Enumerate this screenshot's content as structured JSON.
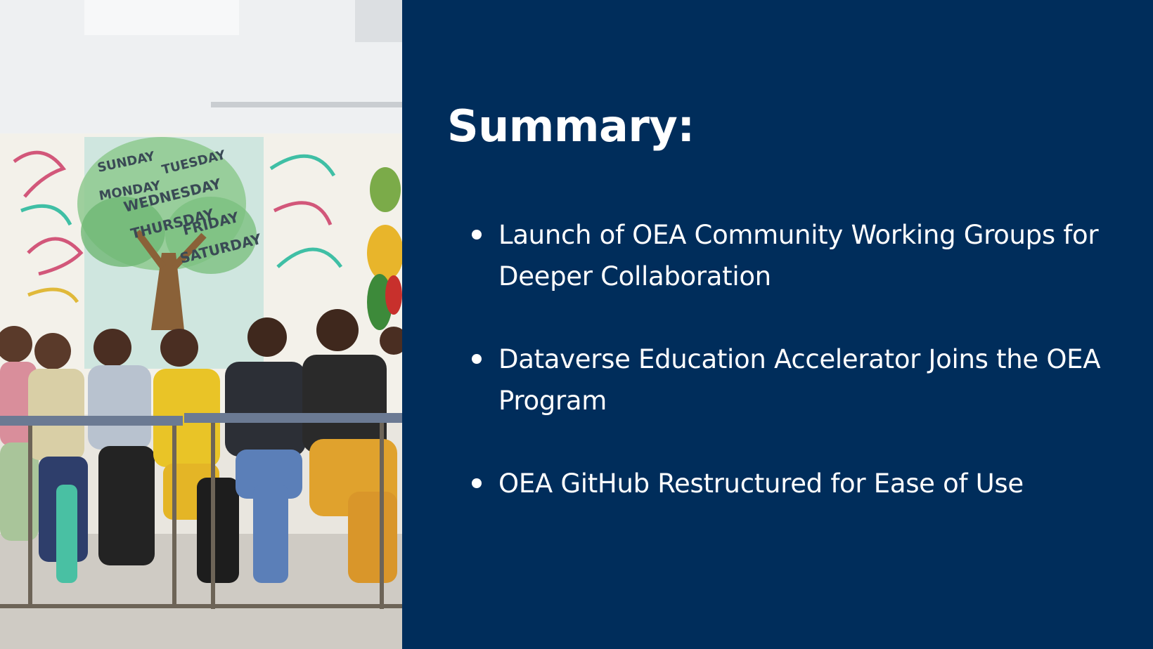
{
  "colors": {
    "background": "#002d5b",
    "text": "#ffffff"
  },
  "photo": {
    "icon": "classroom-photo",
    "wall_days": [
      "SUNDAY",
      "MONDAY",
      "TUESDAY",
      "WEDNESDAY",
      "THURSDAY",
      "FRIDAY",
      "SATURDAY"
    ]
  },
  "slide": {
    "title": "Summary:",
    "bullets": [
      {
        "text": "Launch of OEA Community Working Groups for Deeper Collaboration"
      },
      {
        "text": "Dataverse Education Accelerator Joins the OEA Program"
      },
      {
        "text": "OEA GitHub Restructured for Ease of Use"
      }
    ]
  }
}
